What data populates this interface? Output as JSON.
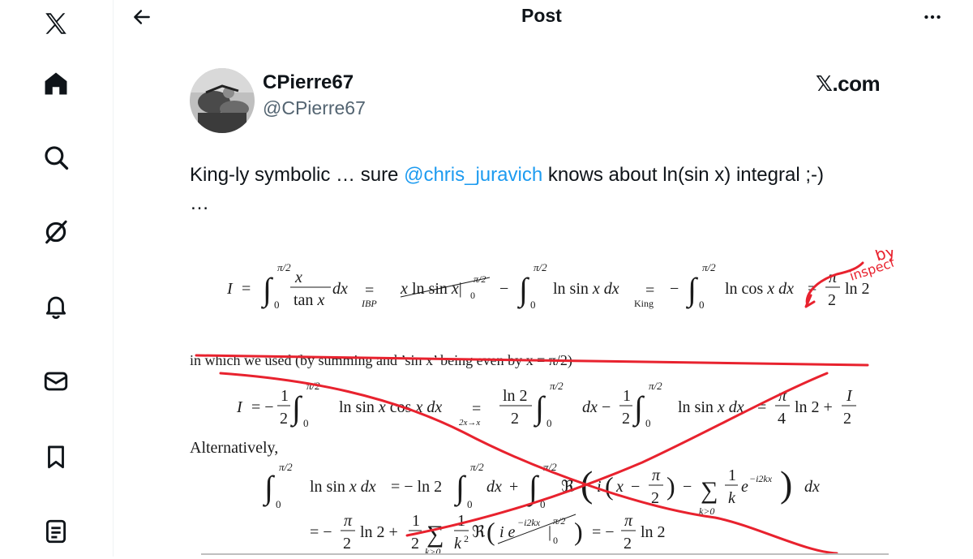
{
  "nav": {
    "items": [
      {
        "name": "x-logo-icon"
      },
      {
        "name": "home-icon"
      },
      {
        "name": "search-icon"
      },
      {
        "name": "grok-icon"
      },
      {
        "name": "bell-icon"
      },
      {
        "name": "messages-icon"
      },
      {
        "name": "bookmark-icon"
      },
      {
        "name": "lists-icon"
      }
    ]
  },
  "header": {
    "title": "Post"
  },
  "post": {
    "display_name": "CPierre67",
    "handle": "@CPierre67",
    "source": "𝕏.com",
    "text_before": "King-ly symbolic … sure ",
    "mention": "@chris_juravich",
    "text_after": " knows about ln(sin x) integral ;-) …"
  },
  "math": {
    "annotation_line1": "by",
    "annotation_line2": "inspection",
    "line_used": "in which we used (by summing and ’sin x’ being even by x = π/2)",
    "alternatively": "Alternatively,",
    "ibp": "IBP",
    "king": "King",
    "sub": "2x→x",
    "sum_sub": "k>0"
  },
  "colors": {
    "accent": "#1d9bf0",
    "ink": "#0f1419",
    "muted": "#536471",
    "annotation_red": "#e8222e"
  }
}
